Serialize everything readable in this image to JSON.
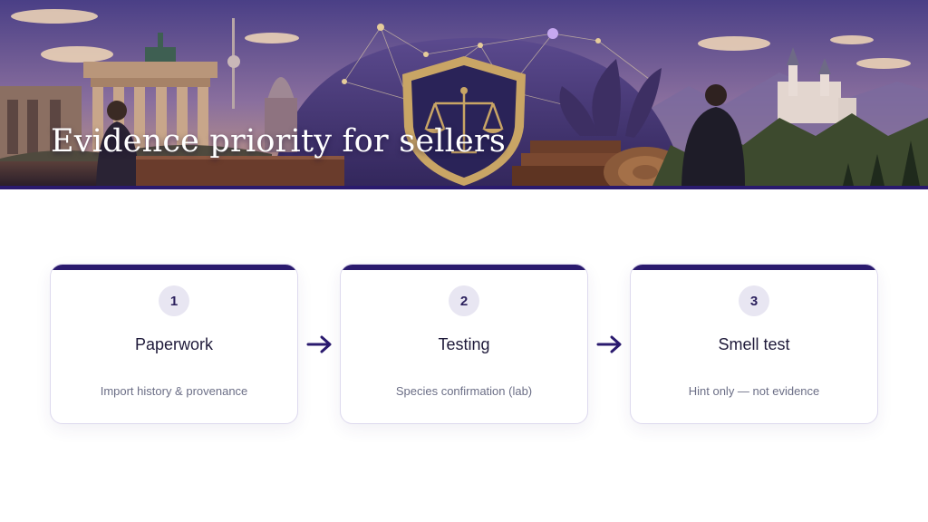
{
  "banner": {
    "title": "Evidence priority for sellers",
    "colors": {
      "sky": "#5a4a8c",
      "accent": "#2a1a6e",
      "shield": "#c9a565"
    }
  },
  "steps": [
    {
      "number": "1",
      "title": "Paperwork",
      "subtitle": "Import history & provenance"
    },
    {
      "number": "2",
      "title": "Testing",
      "subtitle": "Species confirmation (lab)"
    },
    {
      "number": "3",
      "title": "Smell test",
      "subtitle": "Hint only — not evidence"
    }
  ],
  "icons": {
    "connector": "arrow-right-icon",
    "banner_center": "scales-of-justice-icon"
  }
}
